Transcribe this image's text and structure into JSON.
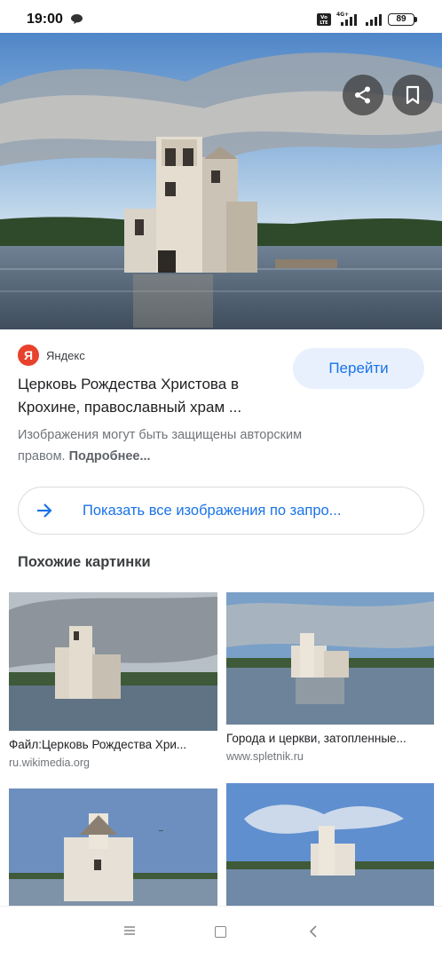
{
  "status_bar": {
    "time": "19:00",
    "network_badge": "Vo LTE",
    "network_type": "4G+",
    "battery": "89",
    "icons": [
      "chat-icon",
      "signal-icon",
      "battery-icon"
    ]
  },
  "hero": {
    "actions": [
      {
        "name": "share",
        "icon": "share-icon"
      },
      {
        "name": "bookmark",
        "icon": "bookmark-icon"
      }
    ]
  },
  "result": {
    "source_logo": "Я",
    "source_name": "Яндекс",
    "goto_label": "Перейти",
    "title_line1": "Церковь Рождества Христова в",
    "title_line2": "Крохине, православный храм ...",
    "copyright_text": "Изображения могут быть защищены авторским правом.",
    "copyright_more": "Подробнее..."
  },
  "show_all": {
    "label": "Показать все изображения по запро..."
  },
  "similar": {
    "heading": "Похожие картинки",
    "items": [
      {
        "caption": "Файл:Церковь Рождества Хри...",
        "domain": "ru.wikimedia.org"
      },
      {
        "caption": "Города и церкви, затопленные...",
        "domain": "www.spletnik.ru"
      },
      {
        "caption": "",
        "domain": ""
      },
      {
        "caption": "",
        "domain": ""
      }
    ]
  },
  "colors": {
    "accent": "#1a73e8",
    "goto_bg": "#e8f0fe",
    "yandex_red": "#e8412c"
  },
  "nav_bar": {
    "icons": [
      "menu-icon",
      "home-icon",
      "back-icon"
    ]
  }
}
